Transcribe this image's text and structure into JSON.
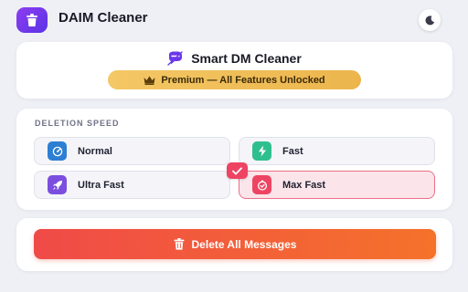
{
  "header": {
    "app_title": "DAIM Cleaner",
    "logo_icon": "trash-icon",
    "theme_toggle_icon": "moon-icon"
  },
  "brand": {
    "title": "Smart DM Cleaner",
    "icon": "chat-bubble-icon",
    "premium_badge": "Premium — All Features Unlocked",
    "premium_icon": "crown-icon"
  },
  "speed": {
    "section_label": "DELETION SPEED",
    "selected": "max_fast",
    "options": [
      {
        "id": "normal",
        "label": "Normal",
        "icon": "gauge-icon",
        "color": "#2d7fd3"
      },
      {
        "id": "fast",
        "label": "Fast",
        "icon": "lightning-icon",
        "color": "#2fbf8f"
      },
      {
        "id": "ultra_fast",
        "label": "Ultra Fast",
        "icon": "rocket-icon",
        "color": "#7b4ee0"
      },
      {
        "id": "max_fast",
        "label": "Max Fast",
        "icon": "stopwatch-icon",
        "color": "#ee4463"
      }
    ]
  },
  "action": {
    "delete_label": "Delete All Messages",
    "delete_icon": "trash-icon"
  },
  "colors": {
    "accent_purple": "#6a37ea",
    "premium_gold": "#f0bf58",
    "danger_start": "#f04a48",
    "danger_end": "#f5722a",
    "selected_border": "#ee6f86"
  }
}
